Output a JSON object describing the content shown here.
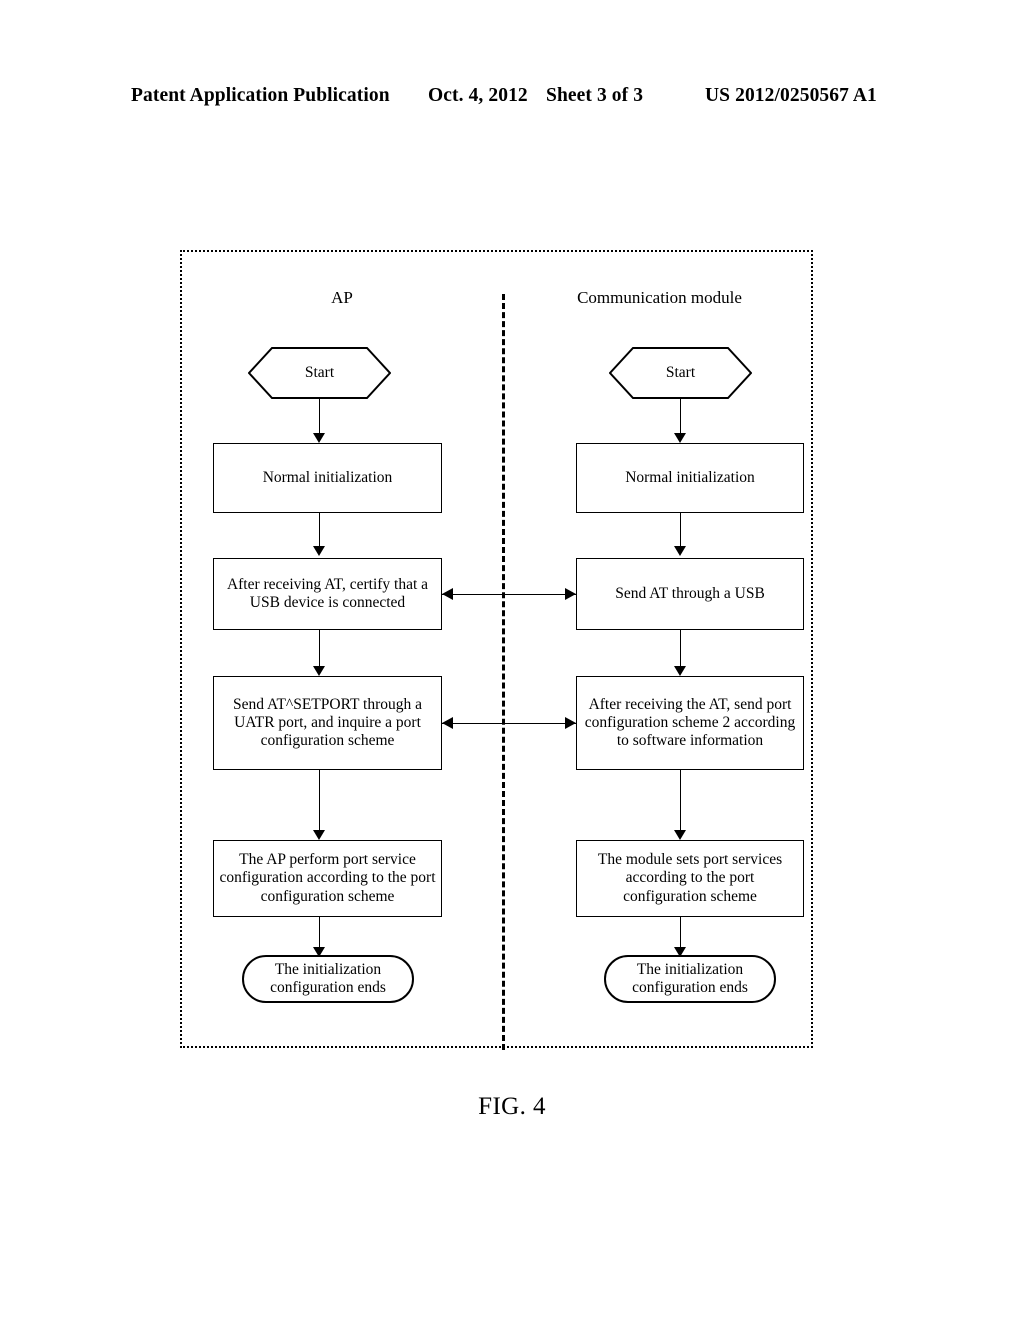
{
  "header": {
    "publication": "Patent Application Publication",
    "date": "Oct. 4, 2012",
    "sheet": "Sheet 3 of 3",
    "patent_number": "US 2012/0250567 A1"
  },
  "figure": {
    "caption": "FIG. 4",
    "lanes": {
      "left": "AP",
      "right": "Communication module"
    },
    "left_nodes": {
      "start": "Start",
      "step1": "Normal initialization",
      "step2": "After receiving AT, certify that a USB device is connected",
      "step3": "Send AT^SETPORT through a UATR port, and inquire a port configuration scheme",
      "step4": "The AP perform port service configuration according to the port configuration scheme",
      "end": "The initialization configuration ends"
    },
    "right_nodes": {
      "start": "Start",
      "step1": "Normal initialization",
      "step2": "Send AT through a USB",
      "step3": "After receiving the AT, send port configuration scheme 2 according to software information",
      "step4": "The module sets port services according to the port configuration scheme",
      "end": "The initialization configuration ends"
    }
  }
}
